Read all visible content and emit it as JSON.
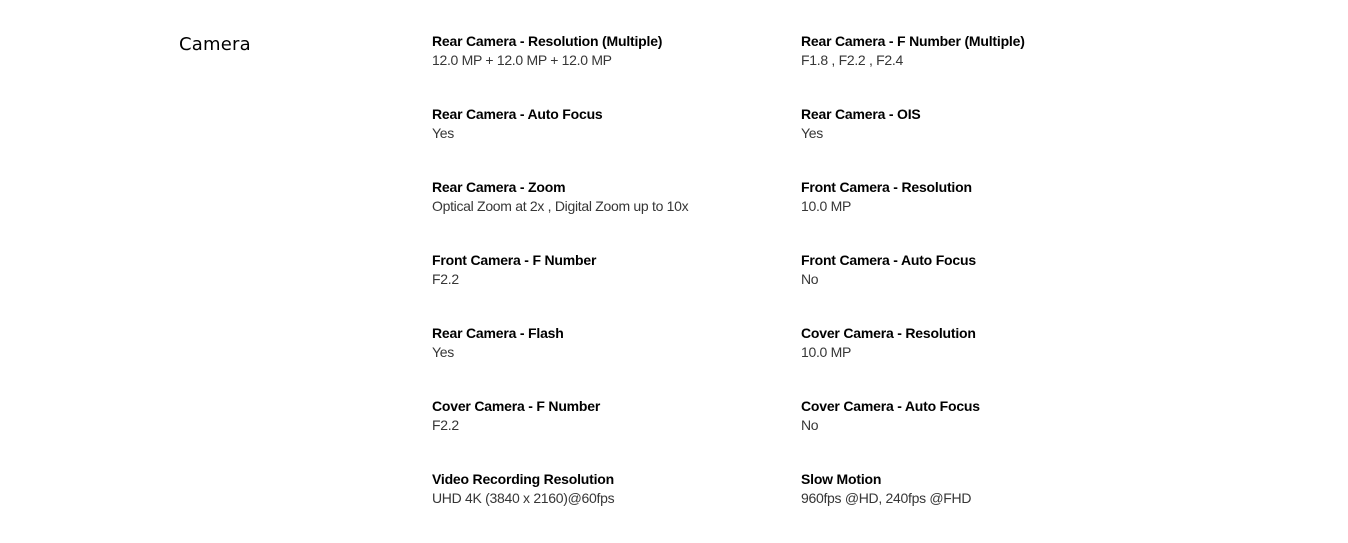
{
  "section": {
    "title": "Camera"
  },
  "specs": [
    {
      "label": "Rear Camera - Resolution (Multiple)",
      "value": "12.0 MP + 12.0 MP + 12.0 MP"
    },
    {
      "label": "Rear Camera - F Number (Multiple)",
      "value": "F1.8 , F2.2 , F2.4"
    },
    {
      "label": "Rear Camera - Auto Focus",
      "value": "Yes"
    },
    {
      "label": "Rear Camera - OIS",
      "value": "Yes"
    },
    {
      "label": "Rear Camera - Zoom",
      "value": "Optical Zoom at 2x , Digital Zoom up to 10x"
    },
    {
      "label": "Front Camera - Resolution",
      "value": "10.0 MP"
    },
    {
      "label": "Front Camera - F Number",
      "value": "F2.2"
    },
    {
      "label": "Front Camera - Auto Focus",
      "value": "No"
    },
    {
      "label": "Rear Camera - Flash",
      "value": "Yes"
    },
    {
      "label": "Cover Camera - Resolution",
      "value": "10.0 MP"
    },
    {
      "label": "Cover Camera - F Number",
      "value": "F2.2"
    },
    {
      "label": "Cover Camera - Auto Focus",
      "value": "No"
    },
    {
      "label": "Video Recording Resolution",
      "value": "UHD 4K (3840 x 2160)@60fps"
    },
    {
      "label": "Slow Motion",
      "value": "960fps @HD, 240fps @FHD"
    }
  ]
}
